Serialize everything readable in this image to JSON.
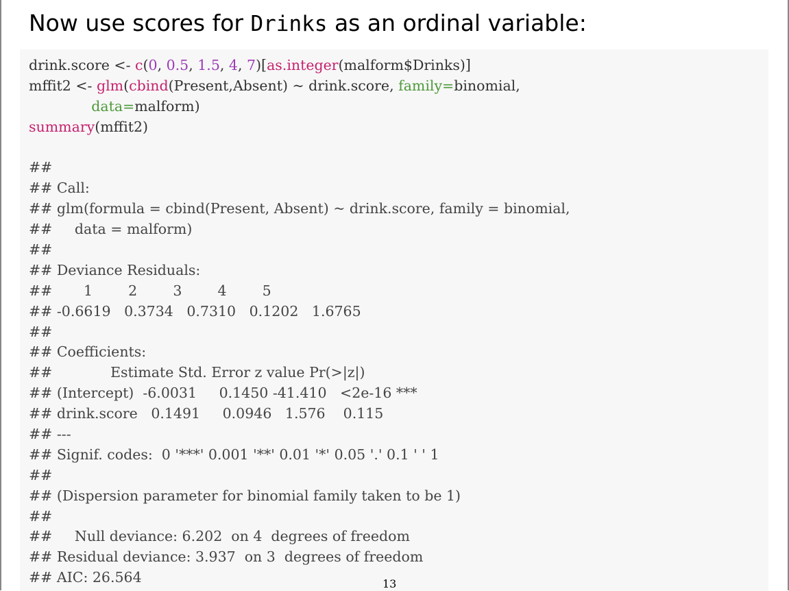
{
  "title": {
    "prefix": "Now use scores for ",
    "mono": "Drinks",
    "suffix": " as an ordinal variable:"
  },
  "code": {
    "l1": [
      {
        "t": "drink.score <- ",
        "c": "plain"
      },
      {
        "t": "c",
        "c": "fn"
      },
      {
        "t": "(",
        "c": "plain"
      },
      {
        "t": "0",
        "c": "num"
      },
      {
        "t": ", ",
        "c": "plain"
      },
      {
        "t": "0.5",
        "c": "num"
      },
      {
        "t": ", ",
        "c": "plain"
      },
      {
        "t": "1.5",
        "c": "num"
      },
      {
        "t": ", ",
        "c": "plain"
      },
      {
        "t": "4",
        "c": "num"
      },
      {
        "t": ", ",
        "c": "plain"
      },
      {
        "t": "7",
        "c": "num"
      },
      {
        "t": ")[",
        "c": "plain"
      },
      {
        "t": "as.integer",
        "c": "fn"
      },
      {
        "t": "(malform$Drinks)]",
        "c": "plain"
      }
    ],
    "l2": [
      {
        "t": "mffit2 <- ",
        "c": "plain"
      },
      {
        "t": "glm",
        "c": "fn"
      },
      {
        "t": "(",
        "c": "plain"
      },
      {
        "t": "cbind",
        "c": "fn"
      },
      {
        "t": "(Present,Absent) ~ drink.score, ",
        "c": "plain"
      },
      {
        "t": "family=",
        "c": "kw"
      },
      {
        "t": "binomial,",
        "c": "plain"
      }
    ],
    "l3": [
      {
        "t": "              ",
        "c": "plain"
      },
      {
        "t": "data=",
        "c": "kw"
      },
      {
        "t": "malform)",
        "c": "plain"
      }
    ],
    "l4": [
      {
        "t": "summary",
        "c": "fn"
      },
      {
        "t": "(mffit2)",
        "c": "plain"
      }
    ]
  },
  "output": [
    "",
    "##",
    "## Call:",
    "## glm(formula = cbind(Present, Absent) ~ drink.score, family = binomial,",
    "##     data = malform)",
    "##",
    "## Deviance Residuals:",
    "##       1        2        3        4        5",
    "## -0.6619   0.3734   0.7310   0.1202   1.6765",
    "##",
    "## Coefficients:",
    "##             Estimate Std. Error z value Pr(>|z|)",
    "## (Intercept)  -6.0031     0.1450 -41.410   <2e-16 ***",
    "## drink.score   0.1491     0.0946   1.576    0.115",
    "## ---",
    "## Signif. codes:  0 '***' 0.001 '**' 0.01 '*' 0.05 '.' 0.1 ' ' 1",
    "##",
    "## (Dispersion parameter for binomial family taken to be 1)",
    "##",
    "##     Null deviance: 6.202  on 4  degrees of freedom",
    "## Residual deviance: 3.937  on 3  degrees of freedom",
    "## AIC: 26.564"
  ],
  "page_number": "13",
  "colors": {
    "code_background": "#f7f7f7",
    "function": "#c5226e",
    "number": "#9b3bb5",
    "argument": "#4d9a3a"
  }
}
